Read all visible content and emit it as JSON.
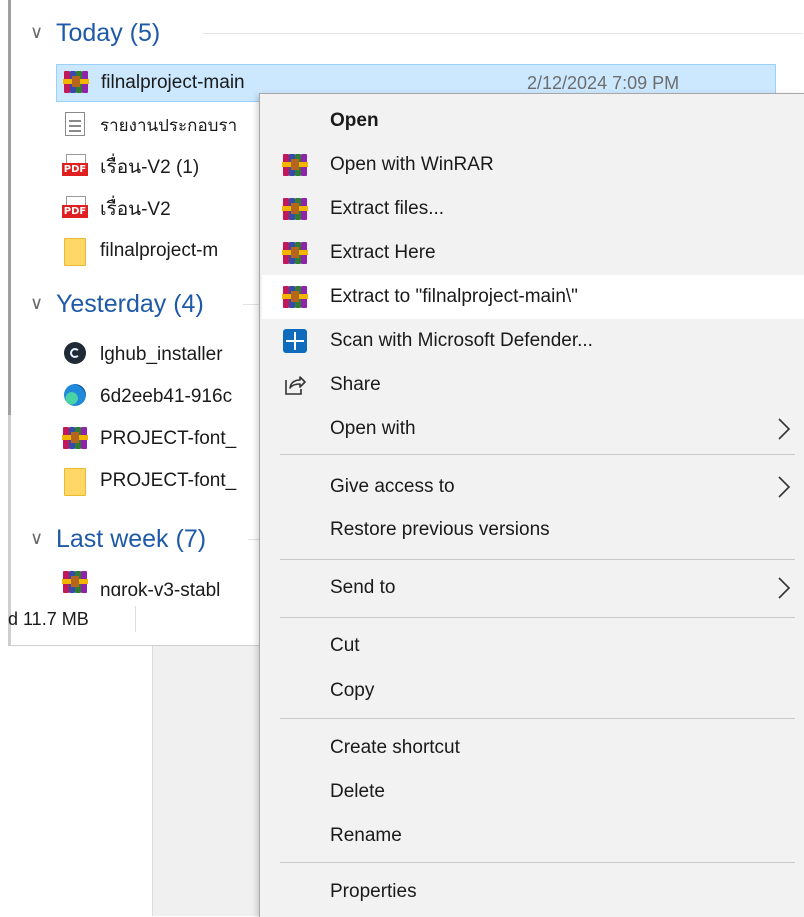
{
  "explorer": {
    "groups": [
      {
        "label": "Today (5)"
      },
      {
        "label": "Yesterday (4)"
      },
      {
        "label": "Last week (7)"
      }
    ],
    "files": [
      {
        "name": "filnalproject-main",
        "date": "2/12/2024 7:09 PM",
        "icon": "winrar-icon",
        "selected": true
      },
      {
        "name": "รายงานประกอบรา",
        "icon": "text-document-icon"
      },
      {
        "name": "เรื่อน-V2 (1)",
        "icon": "pdf-icon"
      },
      {
        "name": "เรื่อน-V2",
        "icon": "pdf-icon"
      },
      {
        "name": "filnalproject-m",
        "icon": "folder-icon"
      },
      {
        "name": "lghub_installer",
        "icon": "logitech-ghub-icon"
      },
      {
        "name": "6d2eeb41-916c",
        "icon": "edge-icon"
      },
      {
        "name": "PROJECT-font_",
        "icon": "winrar-icon"
      },
      {
        "name": "PROJECT-font_",
        "icon": "folder-icon"
      },
      {
        "name": "ngrok-v3-stabl",
        "icon": "winrar-icon"
      }
    ],
    "status": {
      "size": "d 11.7 MB"
    }
  },
  "context_menu": {
    "items": [
      {
        "label": "Open",
        "icon": "",
        "bold": true
      },
      {
        "label": "Open with WinRAR",
        "icon": "winrar-icon"
      },
      {
        "label": "Extract files...",
        "icon": "winrar-icon"
      },
      {
        "label": "Extract Here",
        "icon": "winrar-icon"
      },
      {
        "label": "Extract to \"filnalproject-main\\\"",
        "icon": "winrar-icon",
        "hover": true
      },
      {
        "label": "Scan with Microsoft Defender...",
        "icon": "defender-icon"
      },
      {
        "label": "Share",
        "icon": "share-icon"
      },
      {
        "label": "Open with",
        "submenu": true
      },
      {
        "label": "Give access to",
        "submenu": true
      },
      {
        "label": "Restore previous versions"
      },
      {
        "label": "Send to",
        "submenu": true
      },
      {
        "label": "Cut"
      },
      {
        "label": "Copy"
      },
      {
        "label": "Create shortcut"
      },
      {
        "label": "Delete"
      },
      {
        "label": "Rename"
      },
      {
        "label": "Properties"
      }
    ]
  },
  "colors": {
    "group_header": "#1e5aa8",
    "selection_bg": "#cce8ff",
    "menu_bg": "#f2f2f2",
    "menu_hover": "#ffffff"
  }
}
